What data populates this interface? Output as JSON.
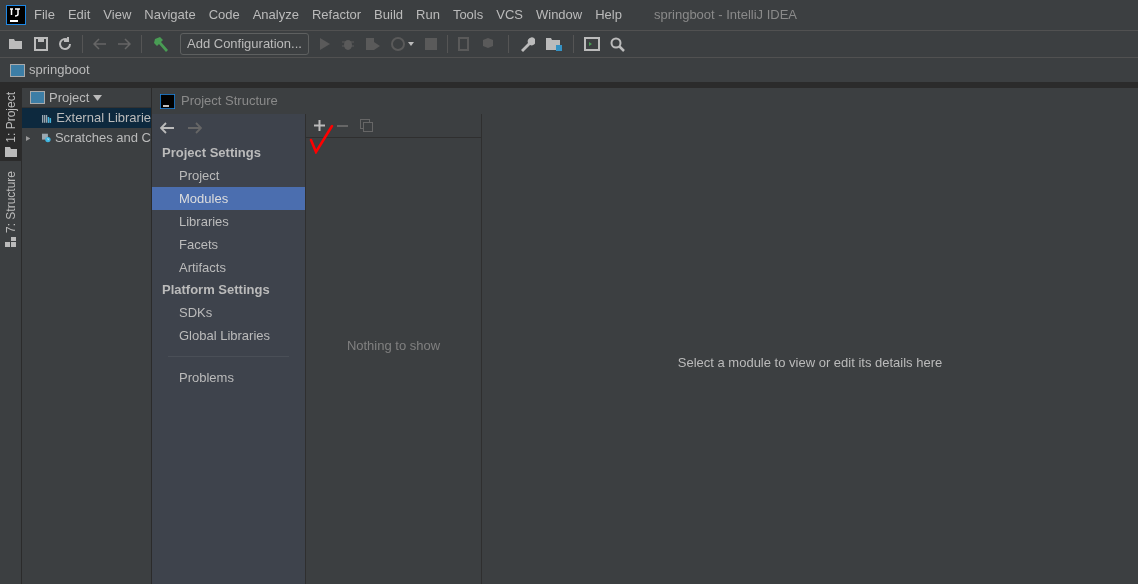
{
  "menu": [
    "File",
    "Edit",
    "View",
    "Navigate",
    "Code",
    "Analyze",
    "Refactor",
    "Build",
    "Run",
    "Tools",
    "VCS",
    "Window",
    "Help"
  ],
  "window": {
    "title": "springboot - IntelliJ IDEA"
  },
  "toolbar": {
    "run_config": "Add Configuration..."
  },
  "breadcrumb": "springboot",
  "tool_strip": [
    {
      "label": "1: Project",
      "selected": true
    },
    {
      "label": "7: Structure",
      "selected": false
    }
  ],
  "project_panel": {
    "title": "Project",
    "items": [
      {
        "label": "External Librarie",
        "kind": "libraries",
        "selected": true
      },
      {
        "label": "Scratches and C",
        "kind": "scratches",
        "selected": false
      }
    ]
  },
  "dialog": {
    "title": "Project Structure",
    "sections": [
      {
        "heading": "Project Settings",
        "items": [
          {
            "label": "Project",
            "selected": false
          },
          {
            "label": "Modules",
            "selected": true
          },
          {
            "label": "Libraries",
            "selected": false
          },
          {
            "label": "Facets",
            "selected": false
          },
          {
            "label": "Artifacts",
            "selected": false
          }
        ]
      },
      {
        "heading": "Platform Settings",
        "items": [
          {
            "label": "SDKs",
            "selected": false
          },
          {
            "label": "Global Libraries",
            "selected": false
          }
        ]
      }
    ],
    "extra_items": [
      {
        "label": "Problems",
        "selected": false
      }
    ],
    "list_empty": "Nothing to show",
    "detail_hint": "Select a module to view or edit its details here"
  }
}
